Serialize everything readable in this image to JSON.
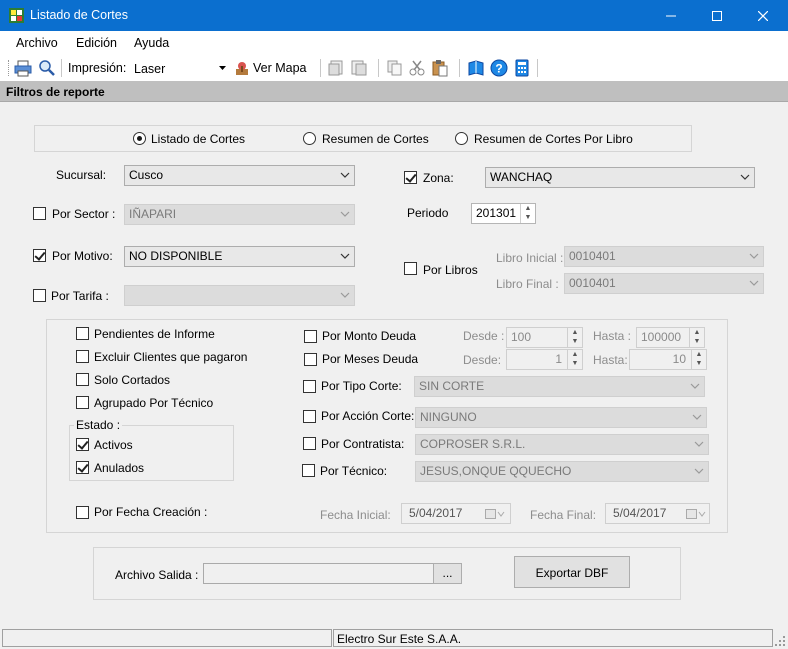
{
  "window": {
    "title": "Listado de Cortes"
  },
  "menu": [
    "Archivo",
    "Edición",
    "Ayuda"
  ],
  "toolbar": {
    "impresion_label": "Impresión:",
    "printer_value": "Laser",
    "ver_mapa": "Ver Mapa"
  },
  "panel": {
    "header": "Filtros de reporte"
  },
  "report_type": {
    "options": [
      "Listado de Cortes",
      "Resumen de Cortes",
      "Resumen de Cortes Por Libro"
    ],
    "selected": "Listado de Cortes"
  },
  "filters": {
    "sucursal": {
      "label": "Sucursal:",
      "value": "Cusco"
    },
    "zona": {
      "label": "Zona:",
      "value": "WANCHAQ",
      "checked": true
    },
    "sector": {
      "label": "Por Sector :",
      "value": "IÑAPARI",
      "checked": false
    },
    "periodo": {
      "label": "Periodo",
      "value": "201301"
    },
    "motivo": {
      "label": "Por Motivo:",
      "value": "NO DISPONIBLE",
      "checked": true
    },
    "libros": {
      "label": "Por Libros",
      "checked": false,
      "inicial_label": "Libro Inicial :",
      "inicial_value": "0010401",
      "final_label": "Libro Final :",
      "final_value": "0010401"
    },
    "tarifa": {
      "label": "Por Tarifa :",
      "value": "",
      "checked": false
    }
  },
  "options": {
    "pendientes": "Pendientes de Informe",
    "excluir": "Excluir Clientes que pagaron",
    "solo_cortados": "Solo Cortados",
    "agrupado": "Agrupado Por Técnico",
    "estado_label": "Estado :",
    "activos": "Activos",
    "anulados": "Anulados",
    "fecha_creacion": "Por Fecha Creación :"
  },
  "right_filters": {
    "monto": {
      "label": "Por Monto Deuda",
      "desde_label": "Desde :",
      "desde": "100",
      "hasta_label": "Hasta :",
      "hasta": "100000"
    },
    "meses": {
      "label": "Por Meses Deuda",
      "desde_label": "Desde:",
      "desde": "1",
      "hasta_label": "Hasta:",
      "hasta": "10"
    },
    "tipo_corte": {
      "label": "Por Tipo Corte:",
      "value": "SIN CORTE"
    },
    "accion": {
      "label": "Por Acción Corte:",
      "value": "NINGUNO"
    },
    "contratista": {
      "label": "Por Contratista:",
      "value": "COPROSER S.R.L."
    },
    "tecnico": {
      "label": "Por Técnico:",
      "value": "JESUS,ONQUE QQUECHO"
    },
    "fecha_inicial_label": "Fecha Inicial:",
    "fecha_inicial": "5/04/2017",
    "fecha_final_label": "Fecha Final:",
    "fecha_final": "5/04/2017"
  },
  "output": {
    "label": "Archivo Salida :",
    "value": "",
    "browse": "...",
    "export": "Exportar DBF"
  },
  "status": {
    "company": "Electro Sur Este S.A.A."
  },
  "colors": {
    "titlebar": "#0b6fcf",
    "panel_header": "#bfbfbf",
    "accent_icon": "#1e88e5"
  }
}
